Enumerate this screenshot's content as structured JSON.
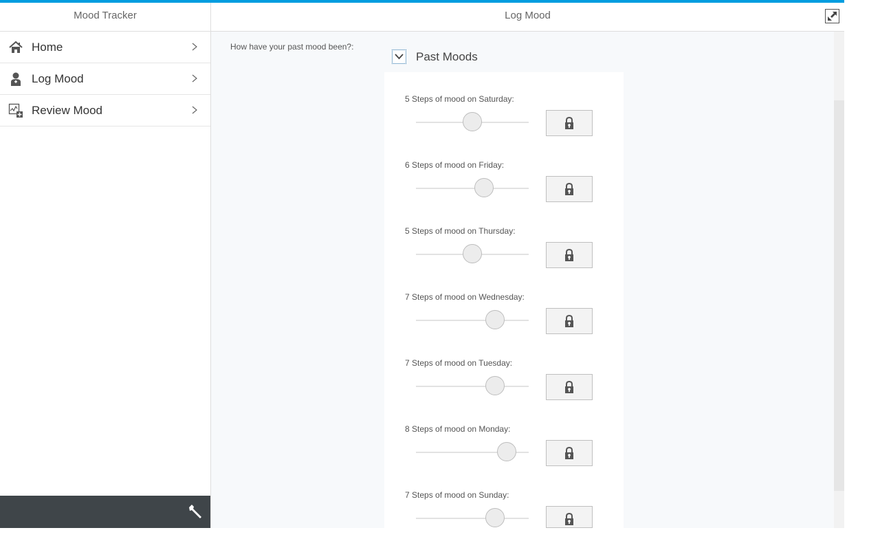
{
  "master": {
    "title": "Mood Tracker",
    "nav_items": [
      {
        "label": "Home",
        "icon": "home-icon"
      },
      {
        "label": "Log Mood",
        "icon": "person-icon"
      },
      {
        "label": "Review Mood",
        "icon": "chart-add-icon"
      }
    ],
    "footer": {
      "settings_icon": "wrench-icon"
    }
  },
  "detail": {
    "title": "Log Mood",
    "fullscreen_icon": "fullscreen-icon",
    "question": "How have your past mood been?:",
    "panel": {
      "title": "Past Moods",
      "expanded": true,
      "rows": [
        {
          "label": "5 Steps of mood on Saturday:",
          "value": 5
        },
        {
          "label": "6 Steps of mood on Friday:",
          "value": 6
        },
        {
          "label": "5 Steps of mood on Thursday:",
          "value": 5
        },
        {
          "label": "7 Steps of mood on Wednesday:",
          "value": 7
        },
        {
          "label": "7 Steps of mood on Tuesday:",
          "value": 7
        },
        {
          "label": "8 Steps of mood on Monday:",
          "value": 8
        },
        {
          "label": "7 Steps of mood on Sunday:",
          "value": 7
        }
      ]
    }
  },
  "colors": {
    "accent": "#009de0",
    "footer": "#3f4549",
    "background": "#f7f9fb"
  }
}
